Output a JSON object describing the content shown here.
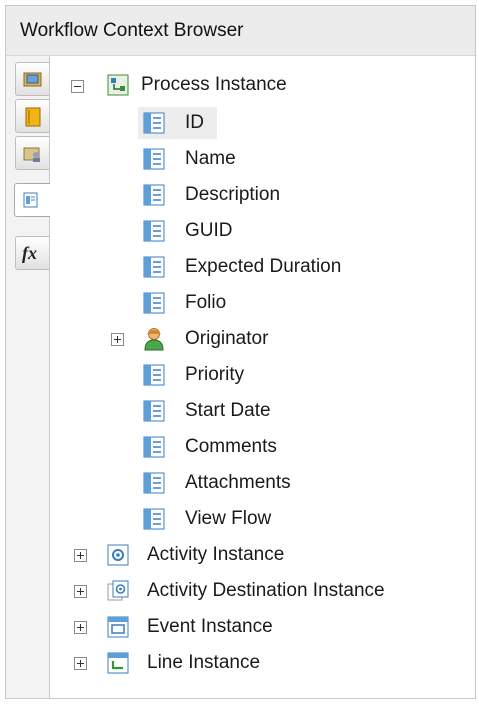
{
  "window": {
    "title": "Workflow Context Browser"
  },
  "side_tabs": [
    {
      "name": "folder-open-icon"
    },
    {
      "name": "notebook-icon"
    },
    {
      "name": "folder-users-icon"
    },
    {
      "name": "context-document-icon",
      "active": true
    },
    {
      "name": "function-icon",
      "glyph": "fx"
    }
  ],
  "tree": {
    "process_instance": {
      "label": "Process Instance",
      "expanded": true,
      "children": [
        {
          "label": "ID",
          "selected": true
        },
        {
          "label": "Name"
        },
        {
          "label": "Description"
        },
        {
          "label": "GUID"
        },
        {
          "label": "Expected Duration"
        },
        {
          "label": "Folio"
        },
        {
          "label": "Originator",
          "expandable": true,
          "icon": "user-icon"
        },
        {
          "label": "Priority"
        },
        {
          "label": "Start Date"
        },
        {
          "label": "Comments"
        },
        {
          "label": "Attachments"
        },
        {
          "label": "View Flow"
        }
      ]
    },
    "roots": [
      {
        "label": "Activity Instance",
        "icon": "activity-icon"
      },
      {
        "label": "Activity Destination Instance",
        "icon": "activity-destination-icon"
      },
      {
        "label": "Event Instance",
        "icon": "event-icon"
      },
      {
        "label": "Line Instance",
        "icon": "line-icon"
      }
    ]
  }
}
